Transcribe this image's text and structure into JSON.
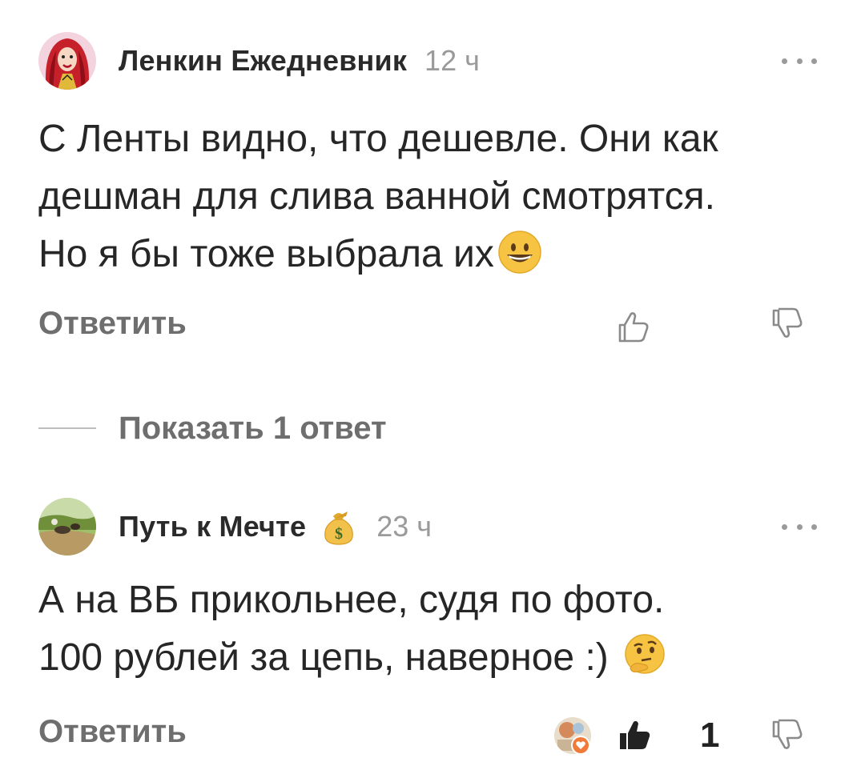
{
  "comments": [
    {
      "author": "Ленкин Ежедневник",
      "time": "12 ч",
      "text_lines": [
        "С Ленты видно, что дешевле. Они как",
        "дешман для слива ванной смотрятся.",
        "Но я бы тоже выбрала их"
      ],
      "reply_label": "Ответить",
      "avatar_icon": "avatar-red-hair-woman",
      "emoji": "grinning-face"
    },
    {
      "author": "Путь к Мечте",
      "time": "23 ч",
      "badge_icon": "money-bag-icon",
      "text_lines": [
        "А на ВБ прикольнее, судя по фото.",
        "100 рублей за цепь, наверное :)"
      ],
      "reply_label": "Ответить",
      "avatar_icon": "avatar-landscape-photo",
      "emoji": "thinking-face",
      "like_count": "1"
    }
  ],
  "show_replies_label": "Показать 1 ответ",
  "colors": {
    "text": "#262626",
    "muted": "#9a9a9a",
    "action": "#6e6e6e",
    "emoji_yellow": "#f6c343"
  }
}
